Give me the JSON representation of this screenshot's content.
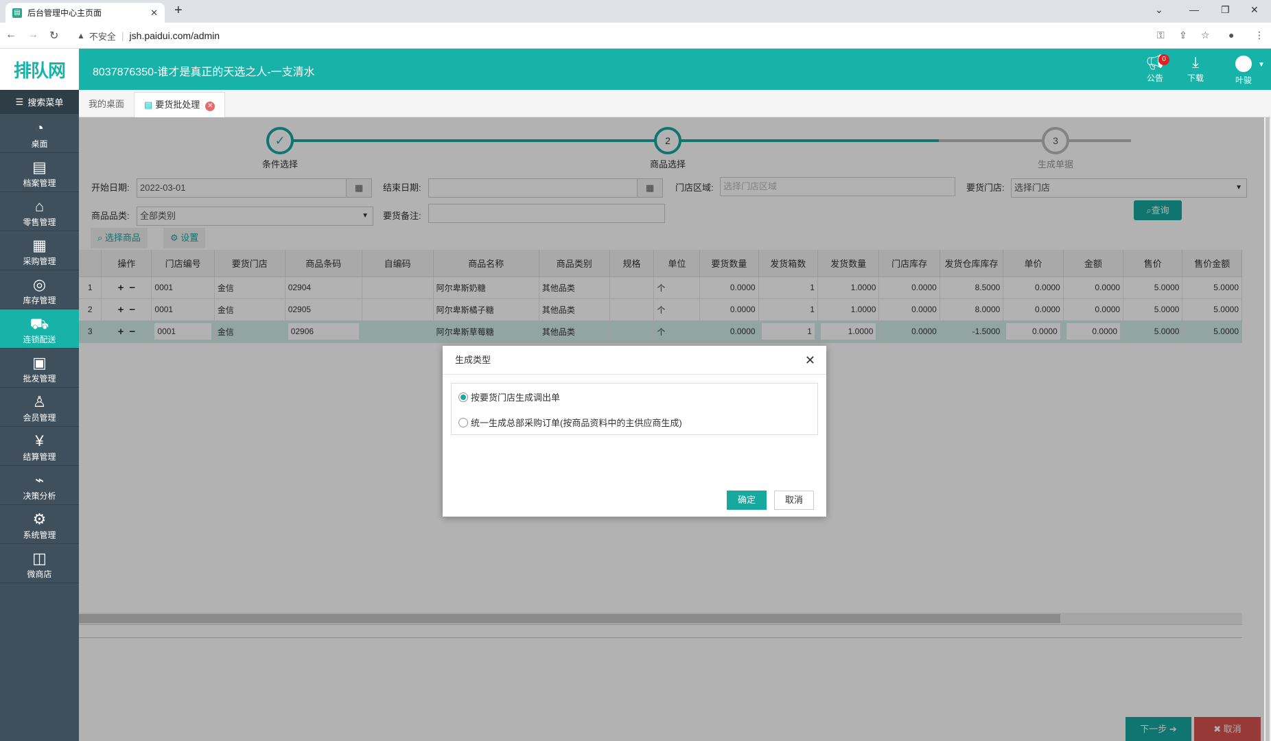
{
  "browser": {
    "tab_title": "后台管理中心主页面",
    "insecure_label": "不安全",
    "url": "jsh.paidui.com/admin"
  },
  "header": {
    "logo_text": "排队网",
    "title": "8037876350-谁才是真正的天选之人-一支清水",
    "notice_label": "公告",
    "notice_count": "0",
    "download_label": "下载",
    "user_name": "叶骏"
  },
  "sidebar": {
    "search_label": "搜索菜单",
    "items": [
      {
        "label": "桌面",
        "icon": "dashboard-icon"
      },
      {
        "label": "档案管理",
        "icon": "archive-icon"
      },
      {
        "label": "零售管理",
        "icon": "store-icon"
      },
      {
        "label": "采购管理",
        "icon": "purchase-icon"
      },
      {
        "label": "库存管理",
        "icon": "inventory-icon"
      },
      {
        "label": "连锁配送",
        "icon": "truck-icon"
      },
      {
        "label": "批发管理",
        "icon": "wholesale-icon"
      },
      {
        "label": "会员管理",
        "icon": "member-icon"
      },
      {
        "label": "结算管理",
        "icon": "settlement-icon"
      },
      {
        "label": "决策分析",
        "icon": "chart-icon"
      },
      {
        "label": "系统管理",
        "icon": "gear-icon"
      },
      {
        "label": "微商店",
        "icon": "shop-bag-icon"
      }
    ]
  },
  "tabs": {
    "desktop": "我的桌面",
    "current": "要货批处理"
  },
  "steps": [
    {
      "label": "条件选择",
      "num": "✓"
    },
    {
      "label": "商品选择",
      "num": "2"
    },
    {
      "label": "生成单据",
      "num": "3"
    }
  ],
  "filters": {
    "start_date_label": "开始日期:",
    "start_date_value": "2022-03-01",
    "end_date_label": "结束日期:",
    "end_date_value": "",
    "area_label": "门店区域:",
    "area_placeholder": "选择门店区域",
    "store_label": "要货门店:",
    "store_value": "选择门店",
    "category_label": "商品品类:",
    "category_value": "全部类别",
    "remark_label": "要货备注:",
    "remark_value": "",
    "query_label": "查询",
    "select_goods_label": "选择商品",
    "settings_label": "设置"
  },
  "grid": {
    "headers": [
      "",
      "操作",
      "门店编号",
      "要货门店",
      "商品条码",
      "自编码",
      "商品名称",
      "商品类别",
      "规格",
      "单位",
      "要货数量",
      "发货箱数",
      "发货数量",
      "门店库存",
      "发货仓库库存",
      "单价",
      "金额",
      "售价",
      "售价金额"
    ],
    "rows": [
      {
        "n": "1",
        "store_no": "0001",
        "store": "金信",
        "barcode": "02904",
        "code": "",
        "name": "阿尔卑斯奶糖",
        "cat": "其他品类",
        "spec": "",
        "unit": "个",
        "req_qty": "0.0000",
        "boxes": "1",
        "ship_qty": "1.0000",
        "store_stock": "0.0000",
        "wh_stock": "8.5000",
        "price": "0.0000",
        "amount": "0.0000",
        "sale_price": "5.0000",
        "sale_amount": "5.0000"
      },
      {
        "n": "2",
        "store_no": "0001",
        "store": "金信",
        "barcode": "02905",
        "code": "",
        "name": "阿尔卑斯橘子糖",
        "cat": "其他品类",
        "spec": "",
        "unit": "个",
        "req_qty": "0.0000",
        "boxes": "1",
        "ship_qty": "1.0000",
        "store_stock": "0.0000",
        "wh_stock": "8.0000",
        "price": "0.0000",
        "amount": "0.0000",
        "sale_price": "5.0000",
        "sale_amount": "5.0000"
      },
      {
        "n": "3",
        "store_no": "0001",
        "store": "金信",
        "barcode": "02906",
        "code": "",
        "name": "阿尔卑斯草莓糖",
        "cat": "其他品类",
        "spec": "",
        "unit": "个",
        "req_qty": "0.0000",
        "boxes": "1",
        "ship_qty": "1.0000",
        "store_stock": "0.0000",
        "wh_stock": "-1.5000",
        "price": "0.0000",
        "amount": "0.0000",
        "sale_price": "5.0000",
        "sale_amount": "5.0000"
      }
    ]
  },
  "footer": {
    "next_label": "下一步",
    "cancel_label": "取消"
  },
  "modal": {
    "title": "生成类型",
    "option1": "按要货门店生成调出单",
    "option2": "统一生成总部采购订单(按商品资料中的主供应商生成)",
    "selected": "option1",
    "ok_label": "确定",
    "cancel_label": "取消"
  },
  "colors": {
    "brand": "#17b3a8",
    "accent": "#17a89e",
    "danger": "#d9534f",
    "sidebar": "#3f4f5b"
  }
}
